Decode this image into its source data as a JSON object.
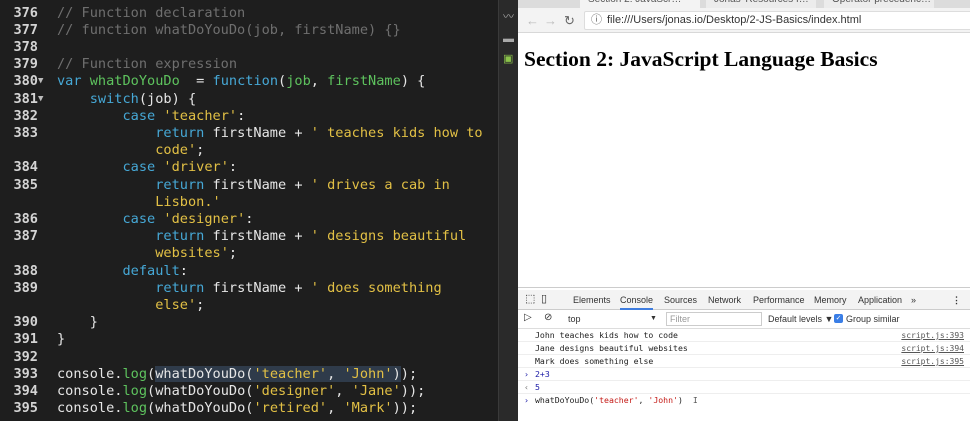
{
  "editor": {
    "lines": [
      {
        "num": "376",
        "fold": "",
        "tokens": [
          [
            "com",
            "// Function declaration"
          ]
        ]
      },
      {
        "num": "377",
        "fold": "",
        "tokens": [
          [
            "com",
            "// function whatDoYouDo(job, firstName) {}"
          ]
        ]
      },
      {
        "num": "378",
        "fold": "",
        "tokens": []
      },
      {
        "num": "379",
        "fold": "",
        "tokens": [
          [
            "com",
            "// Function expression"
          ]
        ]
      },
      {
        "num": "380",
        "fold": "▼",
        "tokens": [
          [
            "kw",
            "var "
          ],
          [
            "fn",
            "whatDoYouDo"
          ],
          [
            "",
            "  = "
          ],
          [
            "kw",
            "function"
          ],
          [
            "",
            "("
          ],
          [
            "fn",
            "job"
          ],
          [
            "",
            ", "
          ],
          [
            "fn",
            "firstName"
          ],
          [
            "",
            ") {"
          ]
        ]
      },
      {
        "num": "381",
        "fold": "▼",
        "tokens": [
          [
            "",
            "    "
          ],
          [
            "kw",
            "switch"
          ],
          [
            "",
            "(job) {"
          ]
        ]
      },
      {
        "num": "382",
        "fold": "",
        "tokens": [
          [
            "",
            "        "
          ],
          [
            "kw",
            "case "
          ],
          [
            "str",
            "'teacher'"
          ],
          [
            "",
            ":"
          ]
        ]
      },
      {
        "num": "383",
        "fold": "",
        "tokens": [
          [
            "",
            "            "
          ],
          [
            "kw",
            "return "
          ],
          [
            "",
            "firstName + "
          ],
          [
            "str",
            "' teaches kids how to"
          ]
        ]
      },
      {
        "num": "",
        "fold": "",
        "tokens": [
          [
            "",
            "            "
          ],
          [
            "str",
            "code'"
          ],
          [
            "",
            ";"
          ]
        ]
      },
      {
        "num": "384",
        "fold": "",
        "tokens": [
          [
            "",
            "        "
          ],
          [
            "kw",
            "case "
          ],
          [
            "str",
            "'driver'"
          ],
          [
            "",
            ":"
          ]
        ]
      },
      {
        "num": "385",
        "fold": "",
        "tokens": [
          [
            "",
            "            "
          ],
          [
            "kw",
            "return "
          ],
          [
            "",
            "firstName + "
          ],
          [
            "str",
            "' drives a cab in"
          ]
        ]
      },
      {
        "num": "",
        "fold": "",
        "tokens": [
          [
            "",
            "            "
          ],
          [
            "str",
            "Lisbon.'"
          ]
        ]
      },
      {
        "num": "386",
        "fold": "",
        "tokens": [
          [
            "",
            "        "
          ],
          [
            "kw",
            "case "
          ],
          [
            "str",
            "'designer'"
          ],
          [
            "",
            ":"
          ]
        ]
      },
      {
        "num": "387",
        "fold": "",
        "tokens": [
          [
            "",
            "            "
          ],
          [
            "kw",
            "return "
          ],
          [
            "",
            "firstName + "
          ],
          [
            "str",
            "' designs beautiful"
          ]
        ]
      },
      {
        "num": "",
        "fold": "",
        "tokens": [
          [
            "",
            "            "
          ],
          [
            "str",
            "websites'"
          ],
          [
            "",
            ";"
          ]
        ]
      },
      {
        "num": "388",
        "fold": "",
        "tokens": [
          [
            "",
            "        "
          ],
          [
            "kw",
            "default"
          ],
          [
            "",
            ":"
          ]
        ]
      },
      {
        "num": "389",
        "fold": "",
        "tokens": [
          [
            "",
            "            "
          ],
          [
            "kw",
            "return "
          ],
          [
            "",
            "firstName + "
          ],
          [
            "str",
            "' does something"
          ]
        ]
      },
      {
        "num": "",
        "fold": "",
        "tokens": [
          [
            "",
            "            "
          ],
          [
            "str",
            "else'"
          ],
          [
            "",
            ";"
          ]
        ]
      },
      {
        "num": "390",
        "fold": "",
        "tokens": [
          [
            "",
            "    }"
          ]
        ]
      },
      {
        "num": "391",
        "fold": "",
        "tokens": [
          [
            "",
            "}"
          ]
        ]
      },
      {
        "num": "392",
        "fold": "",
        "tokens": []
      },
      {
        "num": "393",
        "fold": "",
        "tokens": [
          [
            "",
            "console."
          ],
          [
            "fn",
            "log"
          ],
          [
            "",
            "("
          ],
          [
            "sel",
            "whatDoYouDo("
          ],
          [
            "sel-str",
            "'teacher'"
          ],
          [
            "sel",
            ", "
          ],
          [
            "sel-str",
            "'John'"
          ],
          [
            "sel",
            ")"
          ],
          [
            "",
            ");"
          ]
        ]
      },
      {
        "num": "394",
        "fold": "",
        "tokens": [
          [
            "",
            "console."
          ],
          [
            "fn",
            "log"
          ],
          [
            "",
            "(whatDoYouDo("
          ],
          [
            "str",
            "'designer'"
          ],
          [
            "",
            ", "
          ],
          [
            "str",
            "'Jane'"
          ],
          [
            "",
            "));"
          ]
        ]
      },
      {
        "num": "395",
        "fold": "",
        "tokens": [
          [
            "",
            "console."
          ],
          [
            "fn",
            "log"
          ],
          [
            "",
            "(whatDoYouDo("
          ],
          [
            "str",
            "'retired'"
          ],
          [
            "",
            ", "
          ],
          [
            "str",
            "'Mark'"
          ],
          [
            "",
            "));"
          ]
        ]
      }
    ]
  },
  "browser": {
    "tabs": [
      "Section 2: JavaScr…",
      "Jonas' Resources f…",
      "Operator precedenc…"
    ],
    "url": "file:///Users/jonas.io/Desktop/2-JS-Basics/index.html",
    "heading": "Section 2: JavaScript Language Basics"
  },
  "devtools": {
    "tabs": [
      "Elements",
      "Console",
      "Sources",
      "Network",
      "Performance",
      "Memory",
      "Application",
      "»"
    ],
    "active_tab": "Console",
    "context": "top",
    "filter_placeholder": "Filter",
    "levels": "Default levels ▼",
    "group_similar": "Group similar",
    "group_similar_checked": true,
    "messages": [
      {
        "text": "John teaches kids how to code",
        "source": "script.js:393"
      },
      {
        "text": "Jane designs beautiful websites",
        "source": "script.js:394"
      },
      {
        "text": "Mark does something else",
        "source": "script.js:395"
      }
    ],
    "input1": "2+3",
    "result1": "5",
    "prompt_parts": [
      "whatDoYouDo(",
      "'teacher'",
      ", ",
      "'John'",
      ")"
    ]
  }
}
